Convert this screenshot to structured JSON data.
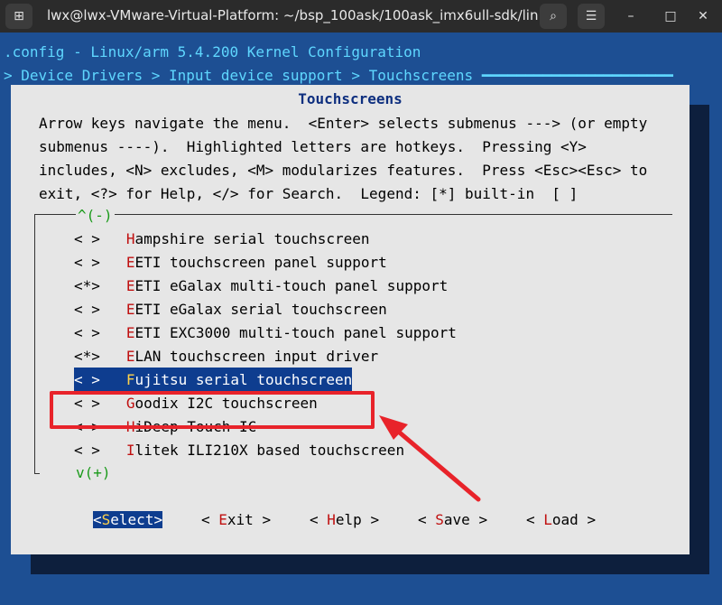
{
  "window": {
    "title": "lwx@lwx-VMware-Virtual-Platform: ~/bsp_100ask/100ask_imx6ull-sdk/lin...",
    "new_tab_glyph": "⊞",
    "search_glyph": "⌕",
    "menu_glyph": "☰",
    "minimize_glyph": "–",
    "maximize_glyph": "□",
    "close_glyph": "✕"
  },
  "terminal": {
    "config_line": ".config - Linux/arm 5.4.200 Kernel Configuration",
    "breadcrumb_line": "> Device Drivers > Input device support > Touchscreens ━━━━━━━━━━━━━━━━━━━━━━"
  },
  "dialog": {
    "title": "Touchscreens",
    "help_text": "Arrow keys navigate the menu.  <Enter> selects submenus ---> (or empty\nsubmenus ----).  Highlighted letters are hotkeys.  Pressing <Y>\nincludes, <N> excludes, <M> modularizes features.  Press <Esc><Esc> to\nexit, <?> for Help, </> for Search.  Legend: [*] built-in  [ ]",
    "scroll_up": "^(-)",
    "scroll_down": "v(+)",
    "items": [
      {
        "state": "< >",
        "hotkey": "H",
        "rest": "ampshire serial touchscreen"
      },
      {
        "state": "< >",
        "hotkey": "E",
        "rest": "ETI touchscreen panel support"
      },
      {
        "state": "<*>",
        "hotkey": "E",
        "rest": "ETI eGalax multi-touch panel support"
      },
      {
        "state": "< >",
        "hotkey": "E",
        "rest": "ETI eGalax serial touchscreen"
      },
      {
        "state": "< >",
        "hotkey": "E",
        "rest": "ETI EXC3000 multi-touch panel support"
      },
      {
        "state": "<*>",
        "hotkey": "E",
        "rest": "LAN touchscreen input driver"
      },
      {
        "state": "< >",
        "hotkey": "F",
        "rest": "ujitsu serial touchscreen"
      },
      {
        "state": "< >",
        "hotkey": "G",
        "rest": "oodix I2C touchscreen"
      },
      {
        "state": "< >",
        "hotkey": "H",
        "rest": "iDeep Touch IC"
      },
      {
        "state": "< >",
        "hotkey": "I",
        "rest": "litek ILI210X based touchscreen"
      }
    ],
    "buttons": {
      "select": {
        "open": "<",
        "hotkey": "S",
        "rest": "elect",
        "close": ">"
      },
      "exit": {
        "open": "< ",
        "hotkey": "E",
        "rest": "xit",
        "close": " >"
      },
      "help": {
        "open": "< ",
        "hotkey": "H",
        "rest": "elp",
        "close": " >"
      },
      "save": {
        "open": "< ",
        "hotkey": "S",
        "rest": "ave",
        "close": " >"
      },
      "load": {
        "open": "< ",
        "hotkey": "L",
        "rest": "oad",
        "close": " >"
      }
    }
  },
  "annotation": {
    "color": "#e8232a"
  }
}
